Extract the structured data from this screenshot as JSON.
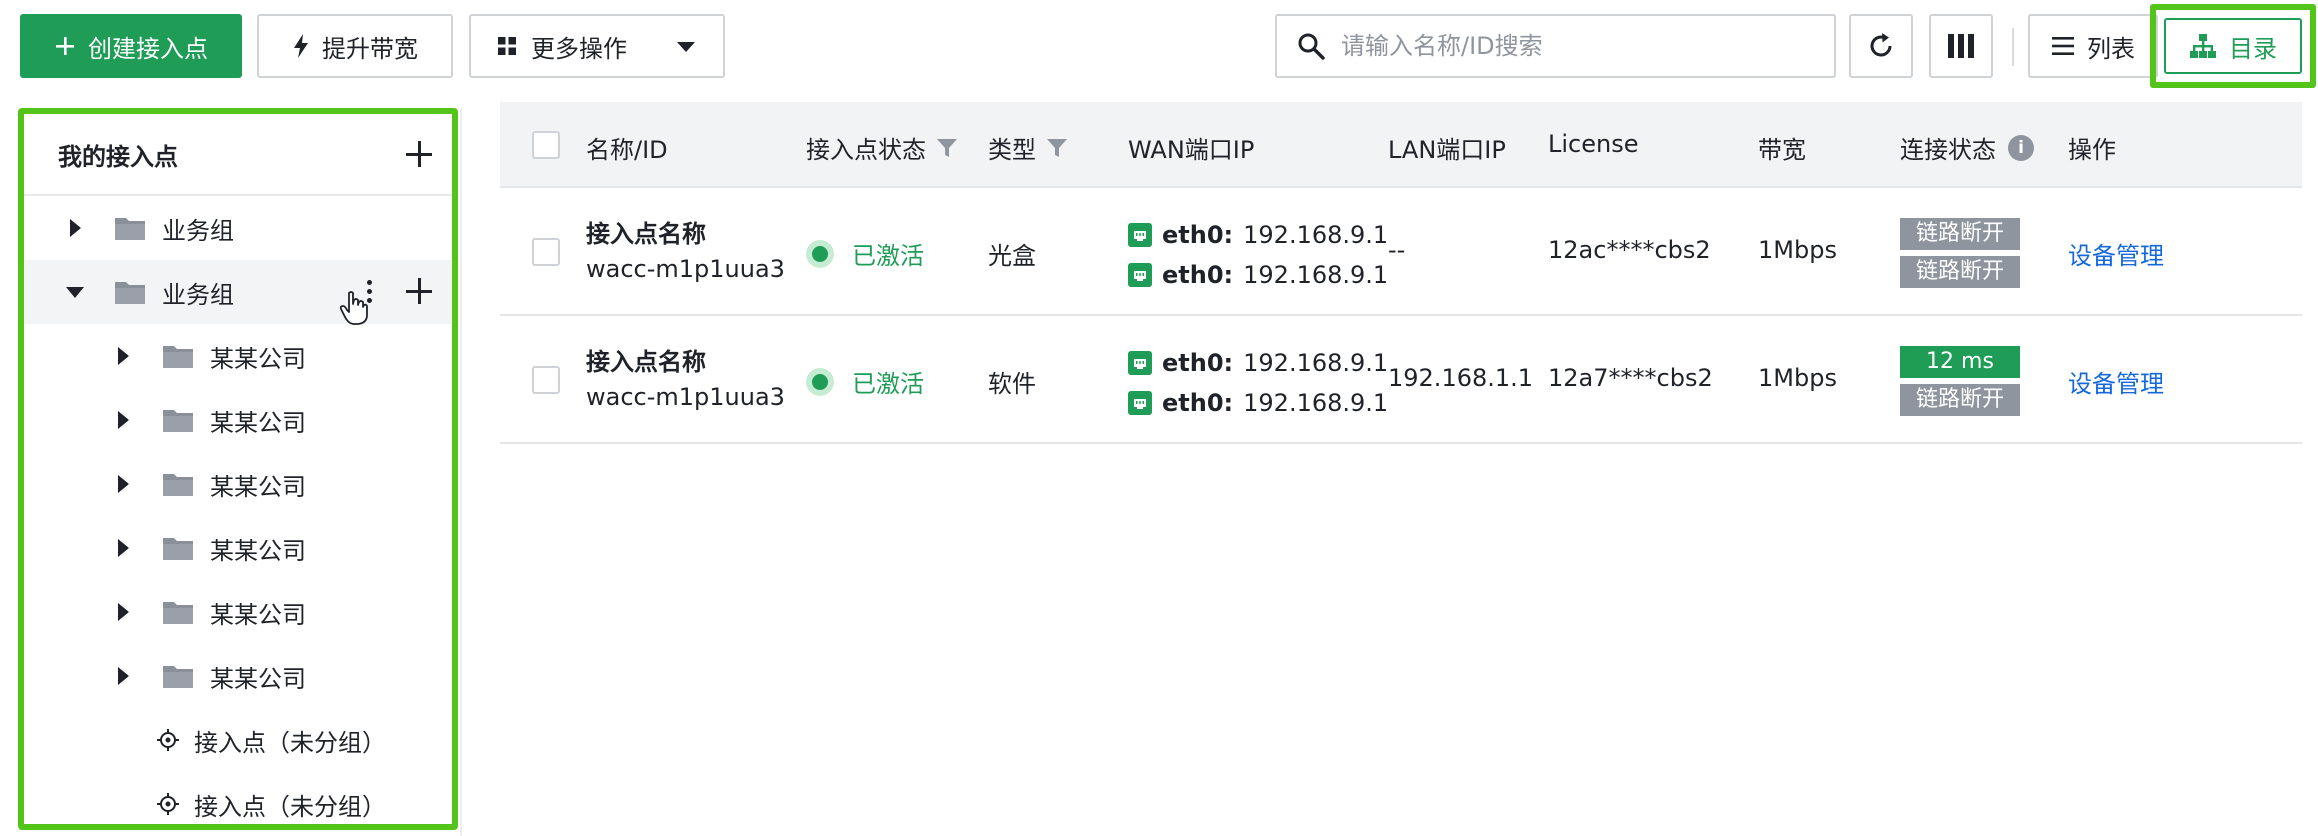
{
  "toolbar": {
    "create_label": "创建接入点",
    "bandwidth_label": "提升带宽",
    "more_label": "更多操作",
    "search_placeholder": "请输入名称/ID搜索",
    "list_label": "列表",
    "directory_label": "目录"
  },
  "tree": {
    "title": "我的接入点",
    "items": [
      {
        "label": "业务组",
        "level": 0,
        "expanded": false
      },
      {
        "label": "业务组",
        "level": 0,
        "expanded": true
      },
      {
        "label": "某某公司",
        "level": 1
      },
      {
        "label": "某某公司",
        "level": 1
      },
      {
        "label": "某某公司",
        "level": 1
      },
      {
        "label": "某某公司",
        "level": 1
      },
      {
        "label": "某某公司",
        "level": 1
      },
      {
        "label": "某某公司",
        "level": 1
      },
      {
        "label": "接入点（未分组）",
        "level": 1
      },
      {
        "label": "接入点（未分组）",
        "level": 1
      }
    ]
  },
  "table": {
    "columns": [
      "名称/ID",
      "接入点状态",
      "类型",
      "WAN端口IP",
      "LAN端口IP",
      "License",
      "带宽",
      "连接状态",
      "操作"
    ],
    "rows": [
      {
        "name": "接入点名称",
        "id": "wacc-m1p1uua3",
        "status": "已激活",
        "type": "光盒",
        "wan": [
          {
            "label": "eth0:",
            "ip": "192.168.9.1"
          },
          {
            "label": "eth0:",
            "ip": "192.168.9.1"
          }
        ],
        "lan": "--",
        "license": "12ac****cbs2",
        "bandwidth": "1Mbps",
        "conn": [
          "链路断开",
          "链路断开"
        ],
        "action": "设备管理"
      },
      {
        "name": "接入点名称",
        "id": "wacc-m1p1uua3",
        "status": "已激活",
        "type": "软件",
        "wan": [
          {
            "label": "eth0:",
            "ip": "192.168.9.1"
          },
          {
            "label": "eth0:",
            "ip": "192.168.9.1"
          }
        ],
        "lan": "192.168.1.1",
        "license": "12a7****cbs2",
        "bandwidth": "1Mbps",
        "conn": [
          "12 ms",
          "链路断开"
        ],
        "action": "设备管理"
      }
    ]
  },
  "colors": {
    "primary": "#1f9d57",
    "highlight": "#52c41a",
    "link": "#1668dc",
    "tag_gray": "#8f959e"
  }
}
